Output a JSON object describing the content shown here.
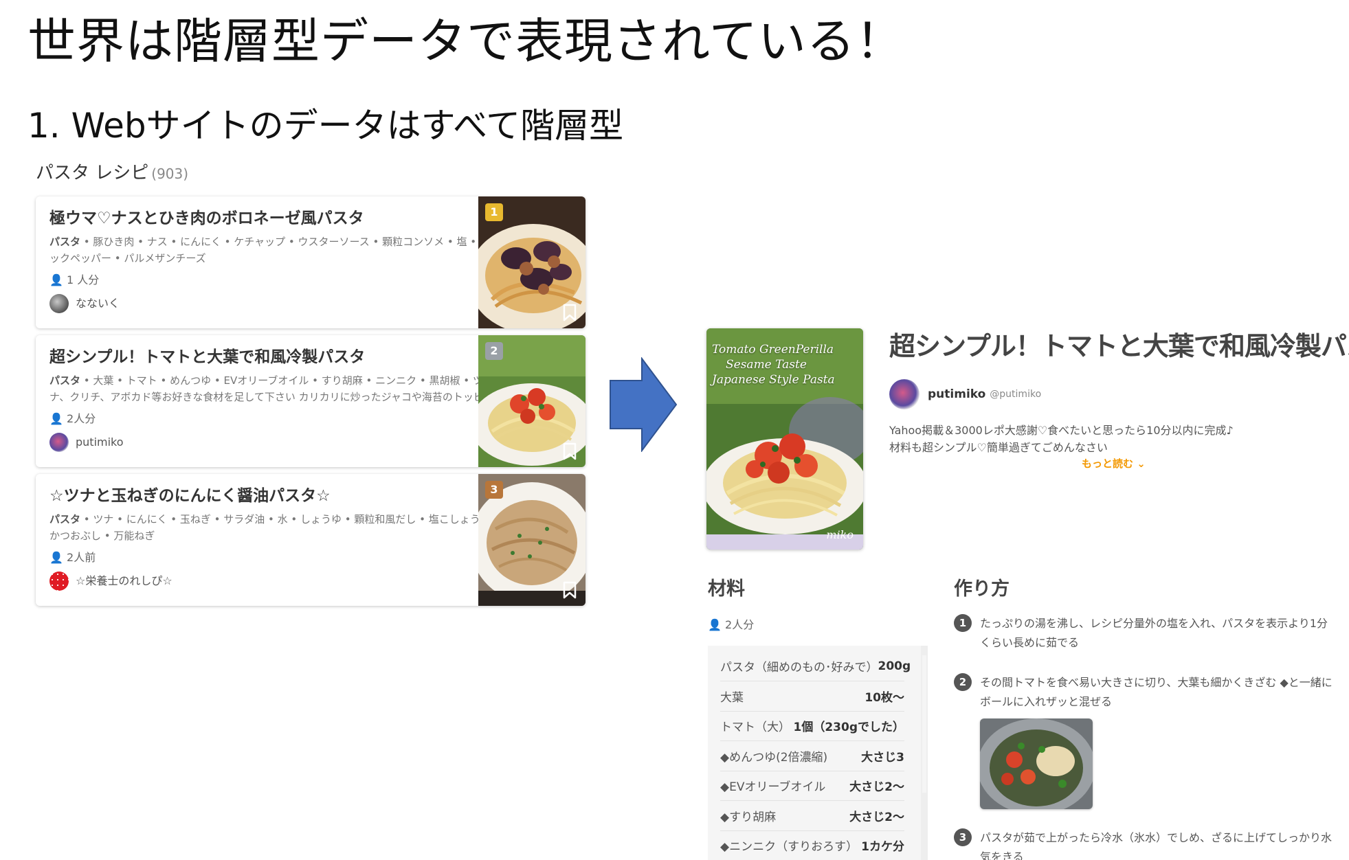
{
  "slide": {
    "title": "世界は階層型データで表現されている！",
    "subtitle": "1. Webサイトのデータはすべて階層型"
  },
  "search_results": {
    "heading": "パスタ レシピ",
    "count": "(903)",
    "cards": [
      {
        "title": "極ウマ♡ナスとひき肉のボロネーゼ風パスタ",
        "ingredients_lead": "パスタ",
        "ingredients_rest": " • 豚ひき肉 • ナス • にんにく • ケチャップ • ウスターソース • 顆粒コンソメ • 塩 • ブラックペッパー • パルメザンチーズ",
        "servings": "1 人分",
        "author": "なないく",
        "rank": "1",
        "rank_color": "#e8b92f"
      },
      {
        "title": "超シンプル！トマトと大葉で和風冷製パスタ",
        "ingredients_lead": "パスタ",
        "ingredients_rest": " • 大葉 • トマト • めんつゆ • EVオリーブオイル • すり胡麻 • ニンニク • 黒胡椒 • ツナ、クリチ、アボカド等お好きな食材を足して下さい カリカリに炒ったジャコや海苔のトッピングもめんつ...",
        "servings": "2人分",
        "author": "putimiko",
        "rank": "2",
        "rank_color": "#9aa0a6"
      },
      {
        "title": "☆ツナと玉ねぎのにんにく醤油パスタ☆",
        "ingredients_lead": "パスタ",
        "ingredients_rest": " • ツナ • にんにく • 玉ねぎ • サラダ油 • 水 • しょうゆ • 顆粒和風だし • 塩こしょう • かつおぶし • 万能ねぎ",
        "servings": "2人前",
        "author": "☆栄養士のれしぴ☆",
        "rank": "3",
        "rank_color": "#b8763a"
      }
    ]
  },
  "recipe": {
    "photo_overlay": [
      "Tomato  GreenPerilla",
      "Sesame  Taste",
      "Japanese Style Pasta"
    ],
    "photo_signature": "miko",
    "title": "超シンプル！トマトと大葉で和風冷製パスタ",
    "author_name": "putimiko",
    "author_handle": "@putimiko",
    "description": [
      "Yahoo掲載＆3000レポ大感謝♡食べたいと思ったら10分以内に完成♪",
      "材料も超シンプル♡簡単過ぎてごめんなさい"
    ],
    "read_more": "もっと読む ⌄",
    "ingredients_heading": "材料",
    "servings": "2人分",
    "ingredients": [
      {
        "name": "パスタ（細めのもの･好みで）",
        "qty": "200g"
      },
      {
        "name": "大葉",
        "qty": "10枚～"
      },
      {
        "name": "トマト（大）",
        "qty": "1個（230gでした）"
      },
      {
        "name": "◆めんつゆ(2倍濃縮)",
        "qty": "大さじ3"
      },
      {
        "name": "◆EVオリーブオイル",
        "qty": "大さじ2～"
      },
      {
        "name": "◆すり胡麻",
        "qty": "大さじ2～"
      },
      {
        "name": "◆ニンニク（すりおろす）",
        "qty": "1カケ分"
      }
    ],
    "steps_heading": "作り方",
    "steps": [
      {
        "num": "1",
        "text": "たっぷりの湯を沸し、レシピ分量外の塩を入れ、パスタを表示より1分くらい長めに茹でる"
      },
      {
        "num": "2",
        "text": "その間トマトを食べ易い大きさに切り、大葉も細かくきざむ ◆と一緒にボールに入れザッと混ぜる"
      },
      {
        "num": "3",
        "text": "パスタが茹で上がったら冷水（氷水）でしめ、ざるに上げてしっかり水気をきる"
      }
    ]
  },
  "colors": {
    "arrow": "#4472c4",
    "arrow_border": "#2f528f",
    "accent": "#f39800"
  }
}
